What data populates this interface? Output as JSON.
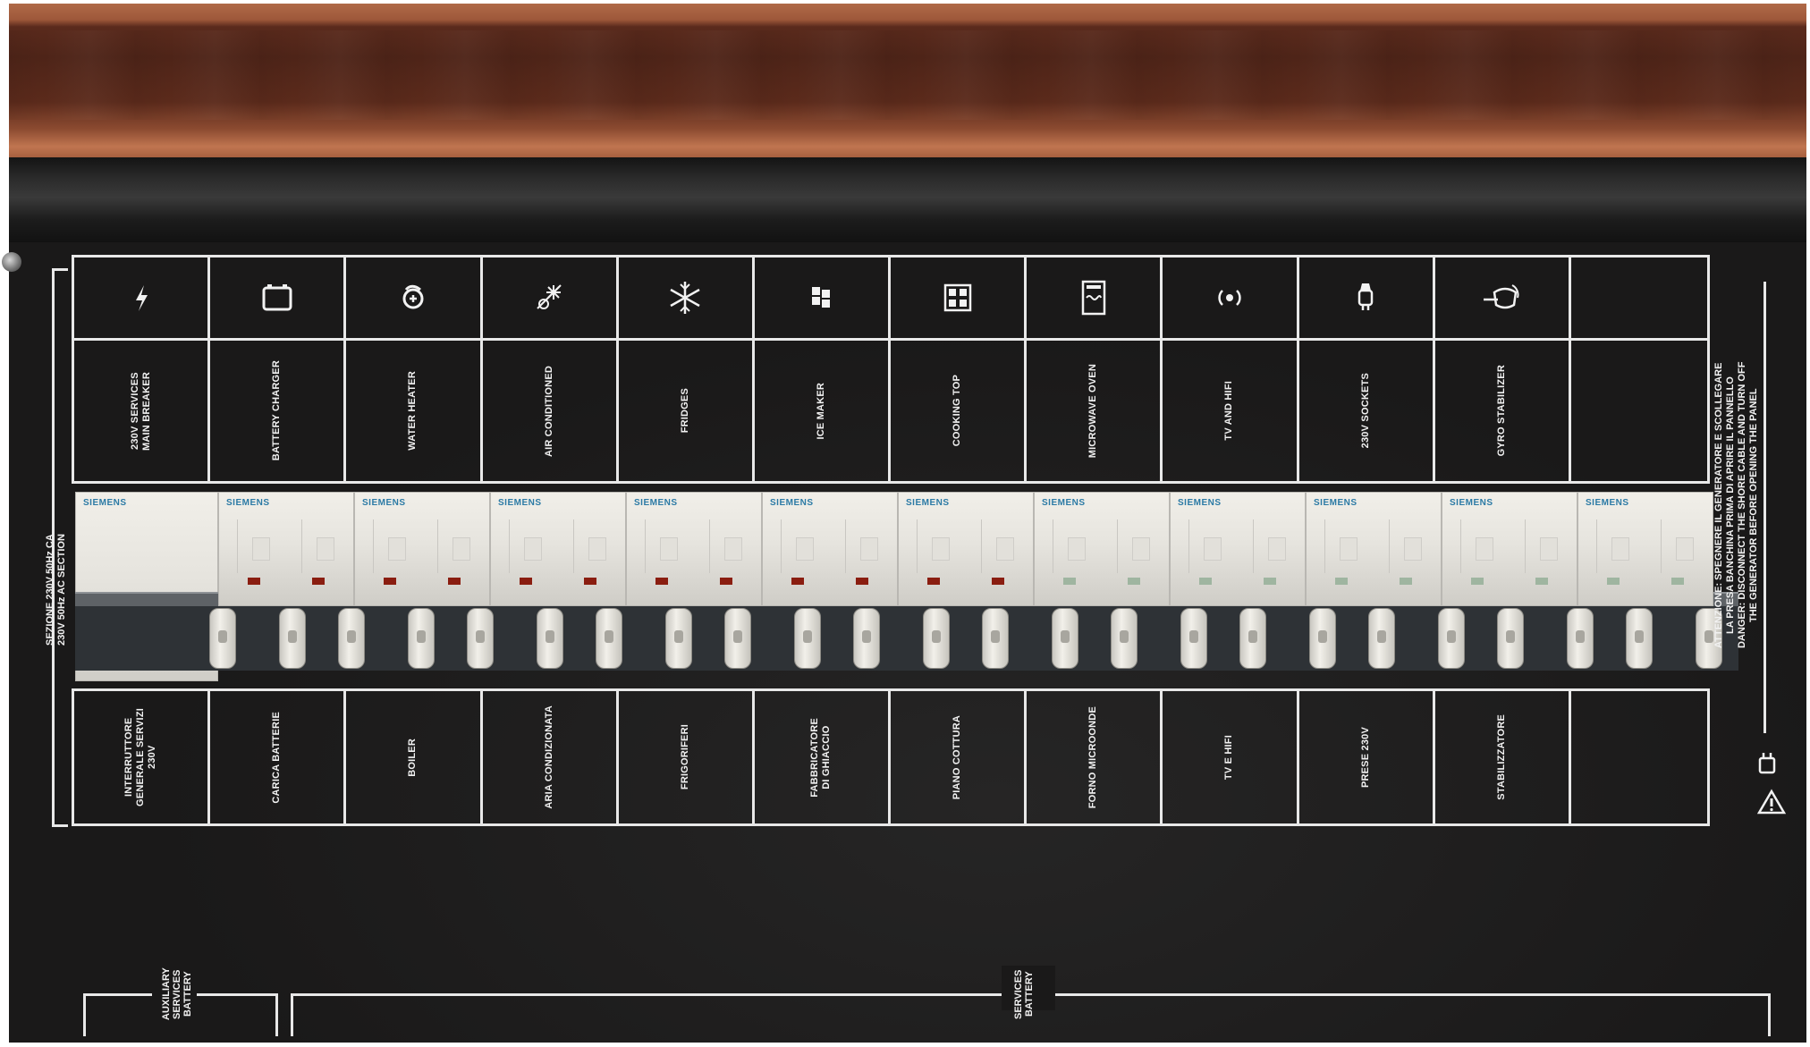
{
  "panel": {
    "left_section_label": "SEZIONE 230V 50Hz CA\n230V 50Hz AC SECTION",
    "right_warning_text": "ATTENZIONE: SPEGNERE IL GENERATORE E SCOLLEGARE\nLA PRESA BANCHINA PRIMA DI APRIRE IL PANNELLO\nDANGER: DISCONNECT THE SHORE CABLE AND TURN OFF\nTHE GENERATOR BEFORE OPENING THE PANEL",
    "bottom_aux_label": "AUXILIARY\nSERVICES\nBATTERY",
    "bottom_services_label": "SERVICES\nBATTERY"
  },
  "circuits": [
    {
      "icon": "lightning-icon",
      "en": "230V SERVICES\nMAIN BREAKER",
      "it": "INTERRUTTORE\nGENERALE SERVIZI\n230V"
    },
    {
      "icon": "battery-icon",
      "en": "BATTERY CHARGER",
      "it": "CARICA BATTERIE"
    },
    {
      "icon": "water-heater-icon",
      "en": "WATER HEATER",
      "it": "BOILER"
    },
    {
      "icon": "air-conditioner-icon",
      "en": "AIR CONDITIONED",
      "it": "ARIA CONDIZIONATA"
    },
    {
      "icon": "snowflake-icon",
      "en": "FRIDGES",
      "it": "FRIGORIFERI"
    },
    {
      "icon": "ice-maker-icon",
      "en": "ICE MAKER",
      "it": "FABBRICATORE\nDI GHIACCIO"
    },
    {
      "icon": "cooktop-icon",
      "en": "COOKING TOP",
      "it": "PIANO COTTURA"
    },
    {
      "icon": "microwave-icon",
      "en": "MICROWAVE OVEN",
      "it": "FORNO MICROONDE"
    },
    {
      "icon": "tv-hifi-icon",
      "en": "TV AND HIFI",
      "it": "TV E HIFI"
    },
    {
      "icon": "socket-icon",
      "en": "230V SOCKETS",
      "it": "PRESE 230V"
    },
    {
      "icon": "gyro-stabilizer-icon",
      "en": "GYRO STABILIZER",
      "it": "STABILIZZATORE"
    },
    {
      "icon": "",
      "en": "",
      "it": ""
    }
  ],
  "breakers": {
    "brand": "SIEMENS",
    "main_switch": "I-OFF"
  },
  "colors": {
    "panel": "#1a1919",
    "label_lines": "#e8e8e8",
    "brand_text": "#2b7aa5",
    "trip_indicator_red": "#8a1d10",
    "trip_indicator_green": "#9fb5a0"
  }
}
